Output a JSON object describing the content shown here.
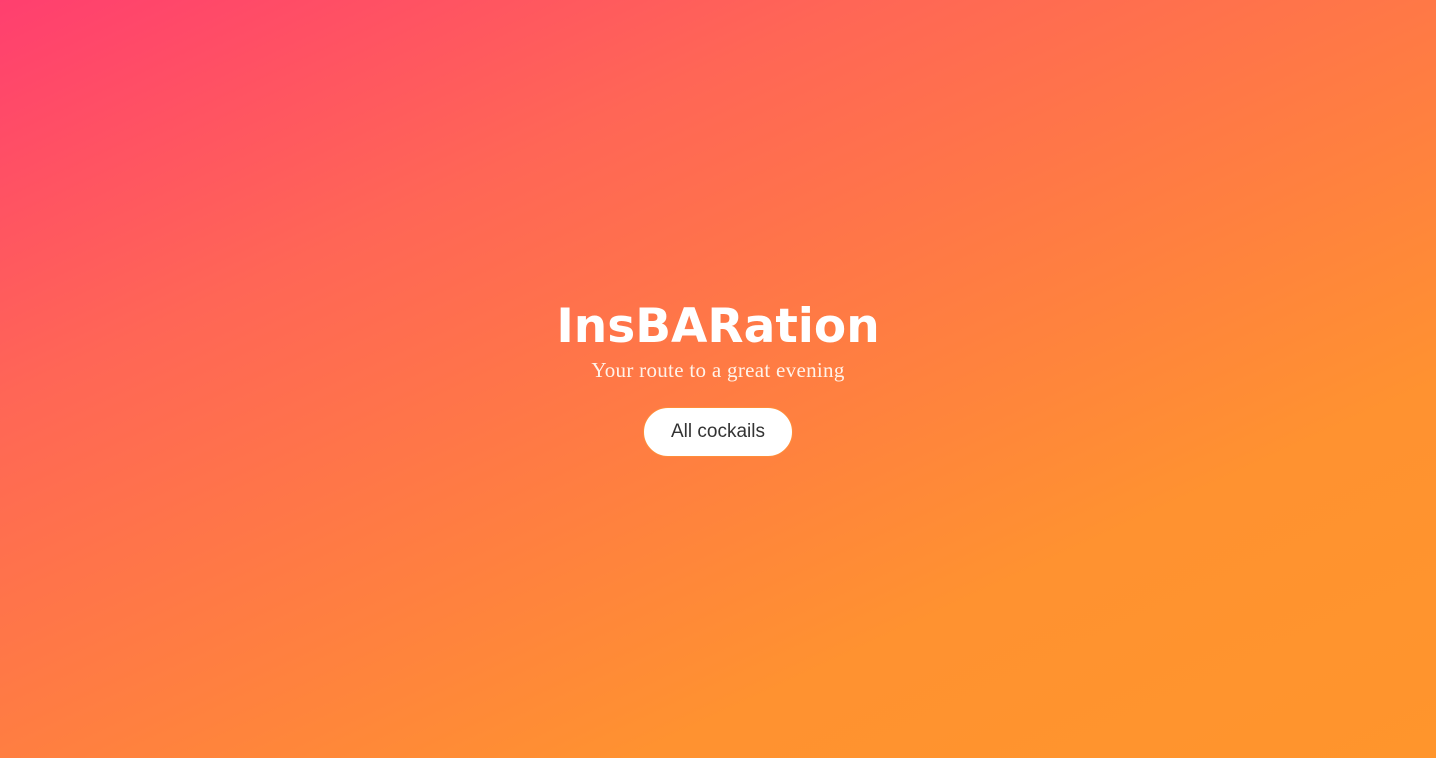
{
  "hero": {
    "title": "InsBARation",
    "subtitle": "Your route to a great evening",
    "button_label": "All cockails"
  },
  "colors": {
    "gradient_start": "#ff3f6f",
    "gradient_end": "#ff952c",
    "title": "#ffffff",
    "button_background": "#ffffff",
    "button_text": "#333333"
  }
}
